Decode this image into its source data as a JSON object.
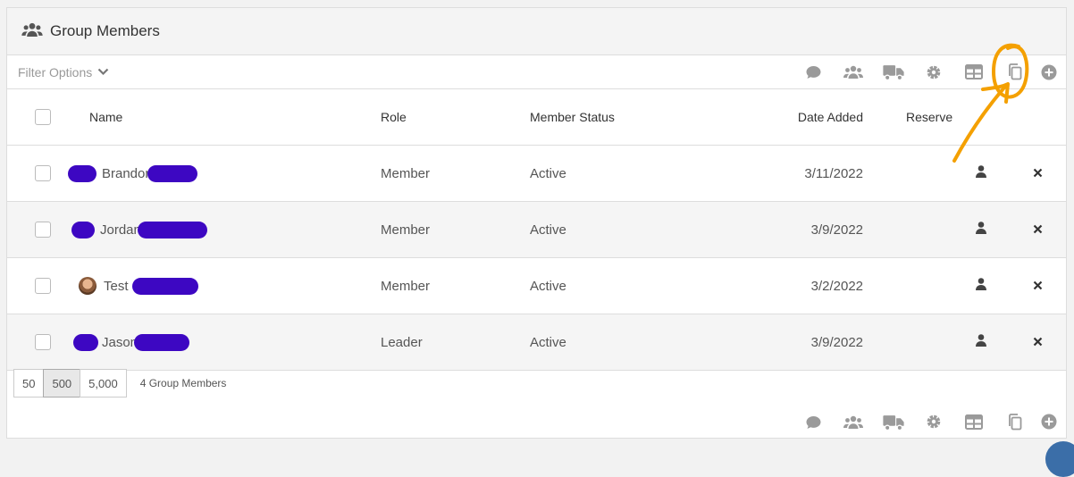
{
  "panel": {
    "title": "Group Members"
  },
  "filter": {
    "label": "Filter Options"
  },
  "columns": {
    "name": "Name",
    "role": "Role",
    "status": "Member Status",
    "date_added": "Date Added",
    "reserve": "Reserve"
  },
  "rows": [
    {
      "name": "Brandon",
      "role": "Member",
      "status": "Active",
      "date_added": "3/11/2022"
    },
    {
      "name": "Jordan",
      "role": "Member",
      "status": "Active",
      "date_added": "3/9/2022"
    },
    {
      "name": "Test",
      "role": "Member",
      "status": "Active",
      "date_added": "3/2/2022"
    },
    {
      "name": "Jason",
      "role": "Leader",
      "status": "Active",
      "date_added": "3/9/2022"
    }
  ],
  "pager": {
    "sizes": [
      "50",
      "500",
      "5,000"
    ],
    "selected": "500"
  },
  "count_label": "4 Group Members",
  "icons": [
    "comment-icon",
    "users-icon",
    "truck-icon",
    "gear-icon",
    "table-icon",
    "copy-icon",
    "add-circle-icon",
    "person-icon",
    "close-icon"
  ],
  "colors": {
    "redaction": "#3d07c2",
    "annotation": "#f4a000",
    "icon": "#9a9a9a"
  }
}
